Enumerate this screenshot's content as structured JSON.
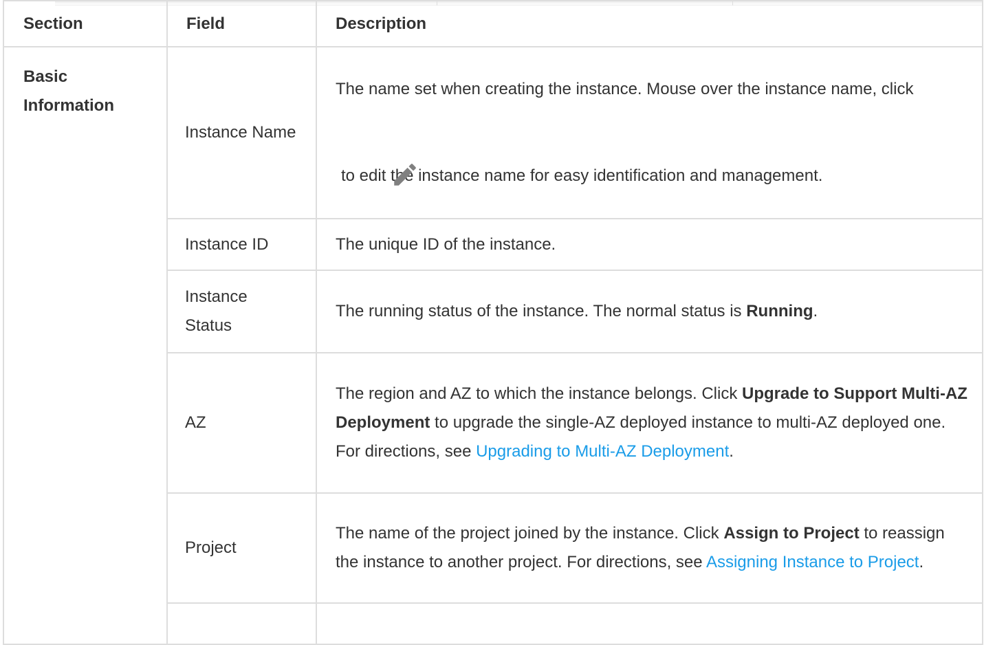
{
  "table": {
    "headers": {
      "section": "Section",
      "field": "Field",
      "description": "Description"
    },
    "section_name": "Basic Information",
    "rows": {
      "instance_name": {
        "field": "Instance Name",
        "desc_before_icon": "The name set when creating the instance. Mouse over the instance name, click",
        "desc_after_icon": " to edit the instance name for easy identification and management.",
        "icon": "pencil-icon"
      },
      "instance_id": {
        "field": "Instance ID",
        "desc": "The unique ID of the instance."
      },
      "instance_status": {
        "field": "Instance Status",
        "desc_prefix": "The running status of the instance. The normal status is ",
        "desc_bold": "Running",
        "desc_suffix": "."
      },
      "az": {
        "field": "AZ",
        "desc_prefix": "The region and AZ to which the instance belongs. Click ",
        "desc_bold": "Upgrade to Support Multi-AZ Deployment",
        "desc_middle": " to upgrade the single-AZ deployed instance to multi-AZ deployed one. For directions, see ",
        "desc_link": "Upgrading to Multi-AZ Deployment",
        "desc_suffix": "."
      },
      "project": {
        "field": "Project",
        "desc_prefix": "The name of the project joined by the instance. Click ",
        "desc_bold": "Assign to Project",
        "desc_middle": " to reassign the instance to another project. For directions, see ",
        "desc_link": "Assigning Instance to Project",
        "desc_suffix": "."
      }
    }
  },
  "colors": {
    "border": "#dddddd",
    "text": "#333333",
    "link": "#1a9ce8",
    "icon": "#808080"
  }
}
